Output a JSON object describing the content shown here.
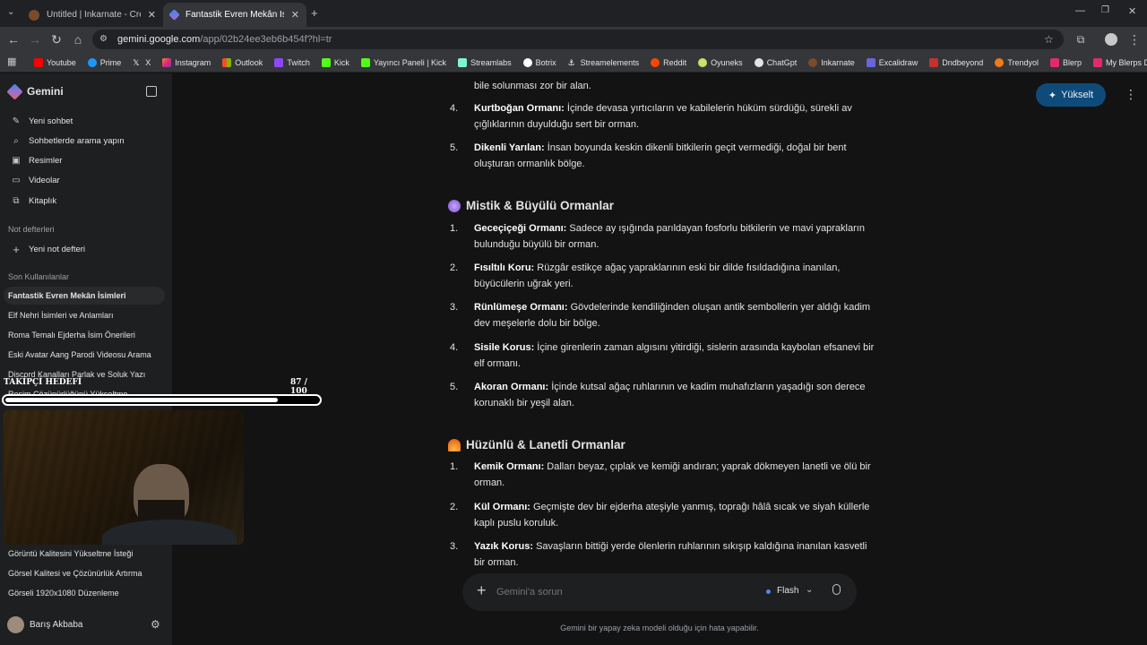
{
  "browser": {
    "tabs": [
      {
        "title": "Untitled | Inkarnate - Create Fa",
        "active": false
      },
      {
        "title": "Fantastik Evren Mekân İsimleri",
        "active": true
      }
    ],
    "url_host": "gemini.google.com",
    "url_path": "/app/02b24ee3eb6b454f?hl=tr",
    "bookmarks": [
      "Youtube",
      "Prime",
      "X",
      "Instagram",
      "Outlook",
      "Twitch",
      "Kick",
      "Yayıncı Paneli | Kick",
      "Streamlabs",
      "Botrix",
      "Streamelements",
      "Reddit",
      "Oyuneks",
      "ChatGpt",
      "Inkarnate",
      "Excalidraw",
      "Dndbeyond",
      "Trendyol",
      "Blerp",
      "My Blerps Dashboard"
    ]
  },
  "sidebar": {
    "brand": "Gemini",
    "nav": [
      {
        "label": "Yeni sohbet",
        "icon": "edit-icon"
      },
      {
        "label": "Sohbetlerde arama yapın",
        "icon": "search-icon"
      },
      {
        "label": "Resimler",
        "icon": "image-icon"
      },
      {
        "label": "Videolar",
        "icon": "video-icon"
      },
      {
        "label": "Kitaplık",
        "icon": "library-icon"
      }
    ],
    "notebooks_heading": "Not defterleri",
    "new_notebook": "Yeni not defteri",
    "recent_heading": "Son Kullanılanlar",
    "recent": [
      "Fantastik Evren Mekân İsimleri",
      "Elf Nehri İsimleri ve Anlamları",
      "Roma Temalı Ejderha İsim Önerileri",
      "Eski Avatar Aang Parodi Videosu Arama",
      "Discord Kanalları Parlak ve Soluk Yazı",
      "Resim Çözünürlüğünü Yükseltme"
    ],
    "recent_bottom": [
      "Görüntü Kalitesini Yükseltme İsteği",
      "Görsel Kalitesi ve Çözünürlük Artırma",
      "Görseli 1920x1080 Düzenleme"
    ],
    "user": "Barış Akbaba"
  },
  "overlay": {
    "goal_label": "TAKİPÇİ HEDEFİ",
    "goal_current": 87,
    "goal_total": 100,
    "goal_text": "87 / 100"
  },
  "header": {
    "upgrade": "Yükselt"
  },
  "content": {
    "top_fragment": "bile solunması zor bir alan.",
    "list_a": [
      {
        "num": "4.",
        "bold": "Kurtboğan Ormanı:",
        "rest": " İçinde devasa yırtıcıların ve kabilelerin hüküm sürdüğü, sürekli av çığlıklarının duyulduğu sert bir orman."
      },
      {
        "num": "5.",
        "bold": "Dikenli Yarılan:",
        "rest": " İnsan boyunda keskin dikenli bitkilerin geçit vermediği, doğal bir bent oluşturan ormanlık bölge."
      }
    ],
    "section_b": "Mistik & Büyülü Ormanlar",
    "list_b": [
      {
        "num": "1.",
        "bold": "Geceçiçeği Ormanı:",
        "rest": " Sadece ay ışığında parıldayan fosforlu bitkilerin ve mavi yaprakların bulunduğu büyülü bir orman."
      },
      {
        "num": "2.",
        "bold": "Fısıltılı Koru:",
        "rest": " Rüzgâr estikçe ağaç yapraklarının eski bir dilde fısıldadığına inanılan, büyücülerin uğrak yeri."
      },
      {
        "num": "3.",
        "bold": "Rünlümeşe Ormanı:",
        "rest": " Gövdelerinde kendiliğinden oluşan antik sembollerin yer aldığı kadim dev meşelerle dolu bir bölge."
      },
      {
        "num": "4.",
        "bold": "Sisile Korus:",
        "rest": " İçine girenlerin zaman algısını yitirdiği, sislerin arasında kaybolan efsanevi bir elf ormanı."
      },
      {
        "num": "5.",
        "bold": "Akoran Ormanı:",
        "rest": " İçinde kutsal ağaç ruhlarının ve kadim muhafızların yaşadığı son derece korunaklı bir yeşil alan."
      }
    ],
    "section_c": "Hüzünlü & Lanetli Ormanlar",
    "list_c": [
      {
        "num": "1.",
        "bold": "Kemik Ormanı:",
        "rest": " Dalları beyaz, çıplak ve kemiği andıran; yaprak dökmeyen lanetli ve ölü bir orman."
      },
      {
        "num": "2.",
        "bold": "Kül Ormanı:",
        "rest": " Geçmişte dev bir ejderha ateşiyle yanmış, toprağı hâlâ sıcak ve siyah küllerle kaplı puslu koruluk."
      },
      {
        "num": "3.",
        "bold": "Yazık Korus:",
        "rest": " Savaşların bittiği yerde ölenlerin ruhlarının sıkışıp kaldığına inanılan kasvetli bir orman."
      }
    ]
  },
  "composer": {
    "placeholder": "Gemini'a sorun",
    "model": "Flash"
  },
  "footer": "Gemini bir yapay zeka modeli olduğu için hata yapabilir.",
  "colors": {
    "accent": "#0f4b7a",
    "goal_bar": "#ffffff",
    "bg": "#131314",
    "sidebar": "#1e1f20"
  }
}
